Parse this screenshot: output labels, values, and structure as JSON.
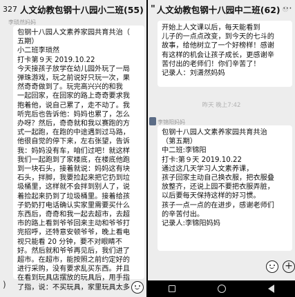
{
  "left_chat": {
    "unread_count": "327",
    "title": "人文幼教包钢十八园小二班(55)",
    "sender": "李琐然妈妈",
    "message_lines": [
      "包钢十八园人文素养家园共育共治（",
      "五期）",
      "小二班李琐然",
      "打卡第９天 2019.10.22",
      "今天接孩子放学在幼儿园外玩了一局",
      "弹珠游戏，玩之前说好只玩一次，果",
      "然奇奇做到了。玩完高兴兴的和我",
      "一起回家，在回家的路上奇奇要求我",
      "抱着他，说自己累了，走不动了。我",
      "听完后也告诉他：妈妈也累了，怎么",
      "办呀？然后，奇奇就和我以赛跑的方",
      "式一起跑，在跑的中途遇到过马路，",
      "他很自觉的停下来，左右张望，告诉",
      "我：妈妈没有车，咱们过吧！就这样",
      "我们一起跑到了家楼底，在楼底他跑",
      "到一块石头，接着就说：妈妈这有块",
      "石头，拌脚，我要捡起来把它扔到垃",
      "圾桶里，这样就不会拌到别人了，说",
      "着捡起来扔到了垃圾桶里。接着给孩",
      "子奶奶打电话确认实家里需要买什么",
      "东西后，奇奇和我一起去超市，去超",
      "市的路上看到爷爷回来主动和爷爷打",
      "完招呼，还特意安顿爷爷，晚上看电",
      "视只能看 20 分钟，要不对眼睛不",
      "好。然后就和爷爷再见后，我们进了",
      "超市。在超市，能按照之前约定好的",
      "进行采购，没有要求乱买东西。并且",
      "在看到玩具店摆放的玩具后，用手指",
      "了指，说：不买玩具，家里玩具太多"
    ],
    "input_placeholder": ")"
  },
  "right_chat": {
    "title": "人文幼教包钢十八园中二班(62)",
    "previous_message_lines": [
      "开始上人文课以后，每天能看到",
      "儿子的一点点改变，到今天的七斗的",
      "故事，给他树立了一个好榜样！感谢",
      "有这样的机会让孩子成长，更感谢辛",
      "苦付出的老师们！你们辛苦了！",
      "记录人：刘潇然妈妈"
    ],
    "timestamp": "昨天 晚上7:42",
    "sender": "李锦阳妈妈",
    "message_lines": [
      "包钢十八园人文素养家园共育共治",
      "（第五期）",
      "中二班:李锦阳",
      "打卡:第９天 2019.10.22",
      "    通过这几天学习人文素养课，",
      "孩子回家主动自己换衣服，把衣服叠",
      "放整齐，还说上园不要把衣服弄脏，",
      "以后要每天保持这样的好习惯。",
      "孩子一点一点的在进步，感谢老师们",
      "的辛苦付出。",
      "记录人:李锦阳妈妈"
    ]
  },
  "icons": {
    "emoji": "emoji-icon",
    "plus": "plus-icon",
    "more": "more-icon",
    "nav_recent": "square-icon",
    "nav_home": "circle-icon",
    "nav_back": "triangle-icon"
  },
  "colors": {
    "background": "#ededed",
    "bubble": "#ffffff",
    "nav_bar": "#000000"
  }
}
